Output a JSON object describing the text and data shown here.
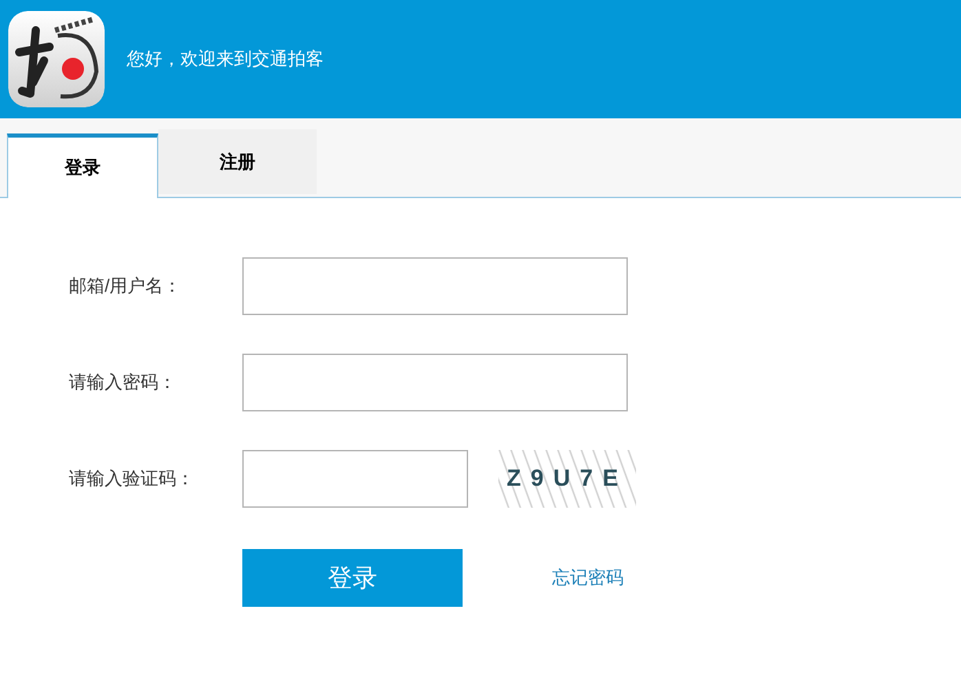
{
  "header": {
    "greeting": "您好，欢迎来到交通拍客"
  },
  "tabs": [
    {
      "label": "登录",
      "selected": true
    },
    {
      "label": "注册",
      "selected": false
    }
  ],
  "fields": [
    {
      "label": "邮箱/用户名：",
      "kind": "text"
    },
    {
      "label": "请输入密码：",
      "kind": "password"
    },
    {
      "label": "请输入验证码：",
      "kind": "captcha",
      "captcha": "Z9U7E"
    }
  ],
  "submit": "登录",
  "forgot": "忘记密码"
}
